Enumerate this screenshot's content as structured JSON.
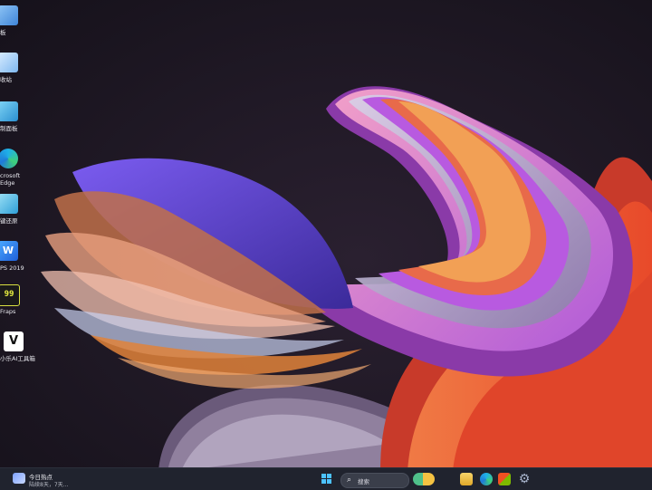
{
  "desktop": {
    "icons": [
      {
        "label": "板",
        "icon": "folder-icon",
        "color": "#5aa0e8"
      },
      {
        "label": "收站",
        "icon": "recycle-bin-icon",
        "color": "#7fb8f0"
      },
      {
        "label": "制面板",
        "icon": "control-panel-icon",
        "color": "#4fb0e0"
      },
      {
        "label": "crosoft Edge",
        "icon": "edge-icon",
        "color": "#2fa8e0"
      },
      {
        "label": "键还原",
        "icon": "restore-icon",
        "color": "#35a0d8"
      },
      {
        "label": "PS 2019",
        "icon": "wps-icon",
        "color": "#2a7ee8"
      },
      {
        "label": "Fraps",
        "icon": "fraps-icon",
        "color": "#d8e040"
      },
      {
        "label": "小乐AI工具箱",
        "icon": "ai-toolbox-icon",
        "color": "#f2f2f2"
      }
    ]
  },
  "taskbar": {
    "news_title": "今日热点",
    "news_subtitle": "陆续8天，7天...",
    "search_label": "搜索",
    "apps": [
      {
        "icon": "widgets-icon",
        "color": "#f5c242"
      },
      {
        "icon": "file-explorer-icon",
        "color": "#f2c14e"
      },
      {
        "icon": "edge-icon",
        "color": "#2fa8e0"
      },
      {
        "icon": "store-icon",
        "color": "#5aa0e8"
      },
      {
        "icon": "settings-icon",
        "color": "#9aa8c0"
      }
    ]
  }
}
